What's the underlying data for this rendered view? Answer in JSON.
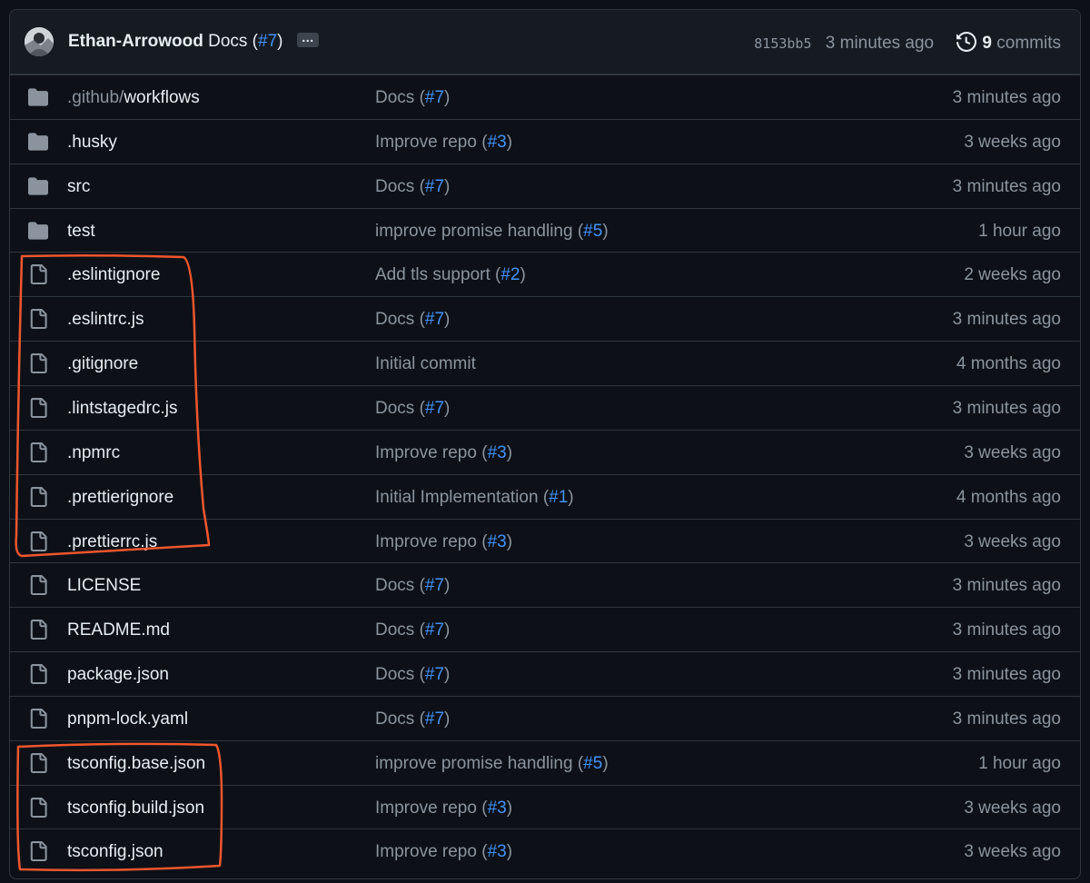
{
  "latest_commit": {
    "author": "Ethan-Arrowood",
    "message": "Docs",
    "pr": "#7",
    "ellipsis": "…",
    "sha": "8153bb5",
    "time": "3 minutes ago",
    "commit_count": "9",
    "commit_label": "commits"
  },
  "files": [
    {
      "type": "folder",
      "prefix": ".github/",
      "name": "workflows",
      "msg": "Docs",
      "pr": "#7",
      "age": "3 minutes ago"
    },
    {
      "type": "folder",
      "prefix": "",
      "name": ".husky",
      "msg": "Improve repo",
      "pr": "#3",
      "age": "3 weeks ago"
    },
    {
      "type": "folder",
      "prefix": "",
      "name": "src",
      "msg": "Docs",
      "pr": "#7",
      "age": "3 minutes ago"
    },
    {
      "type": "folder",
      "prefix": "",
      "name": "test",
      "msg": "improve promise handling",
      "pr": "#5",
      "age": "1 hour ago"
    },
    {
      "type": "file",
      "prefix": "",
      "name": ".eslintignore",
      "msg": "Add tls support",
      "pr": "#2",
      "age": "2 weeks ago"
    },
    {
      "type": "file",
      "prefix": "",
      "name": ".eslintrc.js",
      "msg": "Docs",
      "pr": "#7",
      "age": "3 minutes ago"
    },
    {
      "type": "file",
      "prefix": "",
      "name": ".gitignore",
      "msg": "Initial commit",
      "pr": "",
      "age": "4 months ago"
    },
    {
      "type": "file",
      "prefix": "",
      "name": ".lintstagedrc.js",
      "msg": "Docs",
      "pr": "#7",
      "age": "3 minutes ago"
    },
    {
      "type": "file",
      "prefix": "",
      "name": ".npmrc",
      "msg": "Improve repo",
      "pr": "#3",
      "age": "3 weeks ago"
    },
    {
      "type": "file",
      "prefix": "",
      "name": ".prettierignore",
      "msg": "Initial Implementation",
      "pr": "#1",
      "age": "4 months ago"
    },
    {
      "type": "file",
      "prefix": "",
      "name": ".prettierrc.js",
      "msg": "Improve repo",
      "pr": "#3",
      "age": "3 weeks ago"
    },
    {
      "type": "file",
      "prefix": "",
      "name": "LICENSE",
      "msg": "Docs",
      "pr": "#7",
      "age": "3 minutes ago"
    },
    {
      "type": "file",
      "prefix": "",
      "name": "README.md",
      "msg": "Docs",
      "pr": "#7",
      "age": "3 minutes ago"
    },
    {
      "type": "file",
      "prefix": "",
      "name": "package.json",
      "msg": "Docs",
      "pr": "#7",
      "age": "3 minutes ago"
    },
    {
      "type": "file",
      "prefix": "",
      "name": "pnpm-lock.yaml",
      "msg": "Docs",
      "pr": "#7",
      "age": "3 minutes ago"
    },
    {
      "type": "file",
      "prefix": "",
      "name": "tsconfig.base.json",
      "msg": "improve promise handling",
      "pr": "#5",
      "age": "1 hour ago"
    },
    {
      "type": "file",
      "prefix": "",
      "name": "tsconfig.build.json",
      "msg": "Improve repo",
      "pr": "#3",
      "age": "3 weeks ago"
    },
    {
      "type": "file",
      "prefix": "",
      "name": "tsconfig.json",
      "msg": "Improve repo",
      "pr": "#3",
      "age": "3 weeks ago"
    }
  ],
  "colors": {
    "background": "#0d1117",
    "header_bg": "#161b22",
    "border": "#30363d",
    "text": "#e6edf3",
    "muted": "#8b949e",
    "link": "#4493f8",
    "annotation": "#f0562d"
  }
}
